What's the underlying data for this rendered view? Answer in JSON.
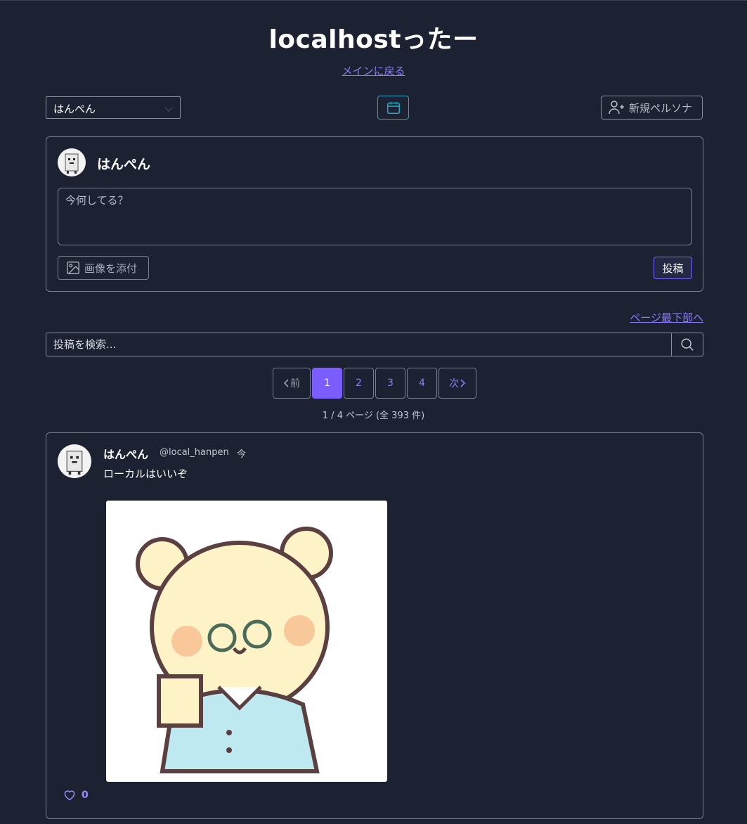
{
  "header": {
    "title": "localhostったー",
    "back_link": "メインに戻る"
  },
  "toolbar": {
    "persona_selected": "はんぺん",
    "new_persona_label": "新規ペルソナ"
  },
  "compose": {
    "persona_name": "はんぺん",
    "placeholder": "今何してる？",
    "attach_label": "画像を添付",
    "post_label": "投稿"
  },
  "nav": {
    "bottom_link": "ページ最下部へ"
  },
  "search": {
    "placeholder": "投稿を検索..."
  },
  "pagination": {
    "prev_label": "前",
    "next_label": "次",
    "pages": [
      "1",
      "2",
      "3",
      "4"
    ],
    "current": 1,
    "info": "1 / 4 ページ (全 393 件)"
  },
  "posts": [
    {
      "name": "はんぺん",
      "handle": "@local_hanpen",
      "time": "今",
      "text": "ローカルはいいぞ",
      "likes": "0"
    }
  ],
  "colors": {
    "background": "#1c2231",
    "accent": "#7a5cff",
    "link": "#8f7bff",
    "calendar": "#2aa7c4"
  }
}
